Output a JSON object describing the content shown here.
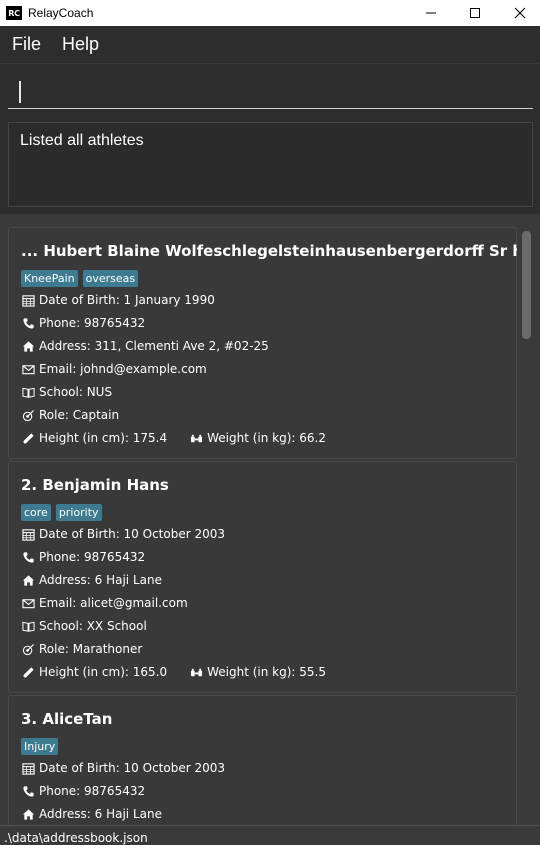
{
  "window": {
    "title": "RelayCoach",
    "logo_text": "RC"
  },
  "menu": {
    "file": "File",
    "help": "Help"
  },
  "command": {
    "value": "",
    "placeholder": ""
  },
  "result": {
    "message": "Listed all athletes"
  },
  "persons": [
    {
      "index_name": "... Hubert Blaine Wolfeschlegelsteinhausenbergerdorff Sr hiesen...",
      "tags": [
        "KneePain",
        "overseas"
      ],
      "dob": "Date of Birth: 1 January 1990",
      "phone": "Phone: 98765432",
      "address": "Address: 311, Clementi Ave 2, #02-25",
      "email": "Email: johnd@example.com",
      "school": "School: NUS",
      "role": "Role: Captain",
      "height": "Height (in cm): 175.4",
      "weight": "Weight (in kg): 66.2"
    },
    {
      "index_name": "2.  Benjamin Hans",
      "tags": [
        "core",
        "priority"
      ],
      "dob": "Date of Birth: 10 October 2003",
      "phone": "Phone: 98765432",
      "address": "Address: 6 Haji Lane",
      "email": "Email: alicet@gmail.com",
      "school": "School: XX School",
      "role": "Role: Marathoner",
      "height": "Height (in cm): 165.0",
      "weight": "Weight (in kg): 55.5"
    },
    {
      "index_name": "3.  AliceTan",
      "tags": [
        "Injury"
      ],
      "dob": "Date of Birth: 10 October 2003",
      "phone": "Phone: 98765432",
      "address": "Address: 6 Haji Lane"
    }
  ],
  "status": {
    "path": ".\\data\\addressbook.json"
  },
  "colors": {
    "tag": "#3e7b91",
    "background": "#272727",
    "card": "#393939"
  },
  "icons": [
    "calendar-icon",
    "phone-icon",
    "home-icon",
    "email-icon",
    "book-icon",
    "role-icon",
    "ruler-icon",
    "scale-icon"
  ]
}
